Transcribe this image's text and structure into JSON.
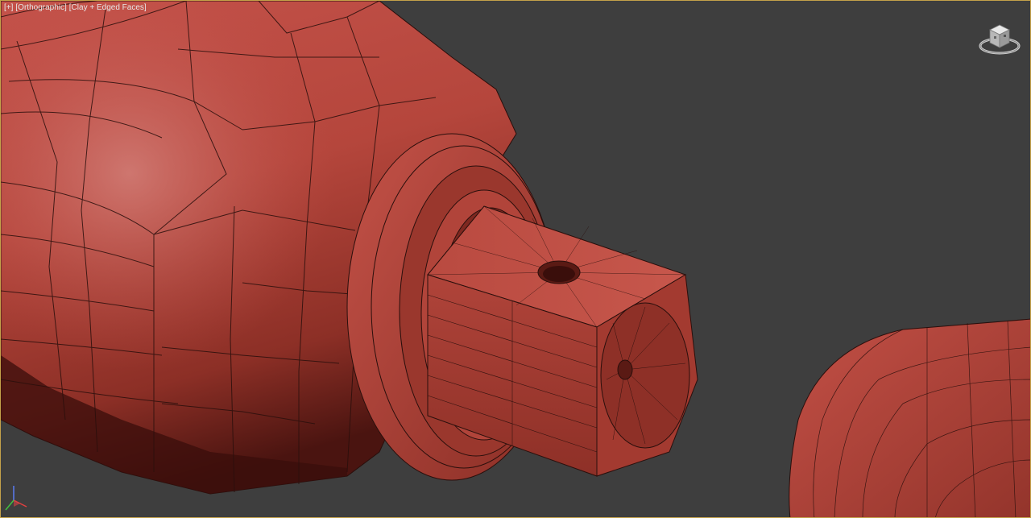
{
  "viewport": {
    "labels": {
      "menu": "[+]",
      "view": "[Orthographic]",
      "shading": "[Clay + Edged Faces]"
    },
    "border_color": "#c4a24a",
    "background_color": "#3e3e3e"
  },
  "scene": {
    "mesh_color": "#b8473c",
    "mesh_dark_color": "#7a231c",
    "wire_color": "#2a0f0c"
  },
  "icons": {
    "viewcube": "viewcube-icon",
    "axis": "axis-tripod-icon"
  }
}
